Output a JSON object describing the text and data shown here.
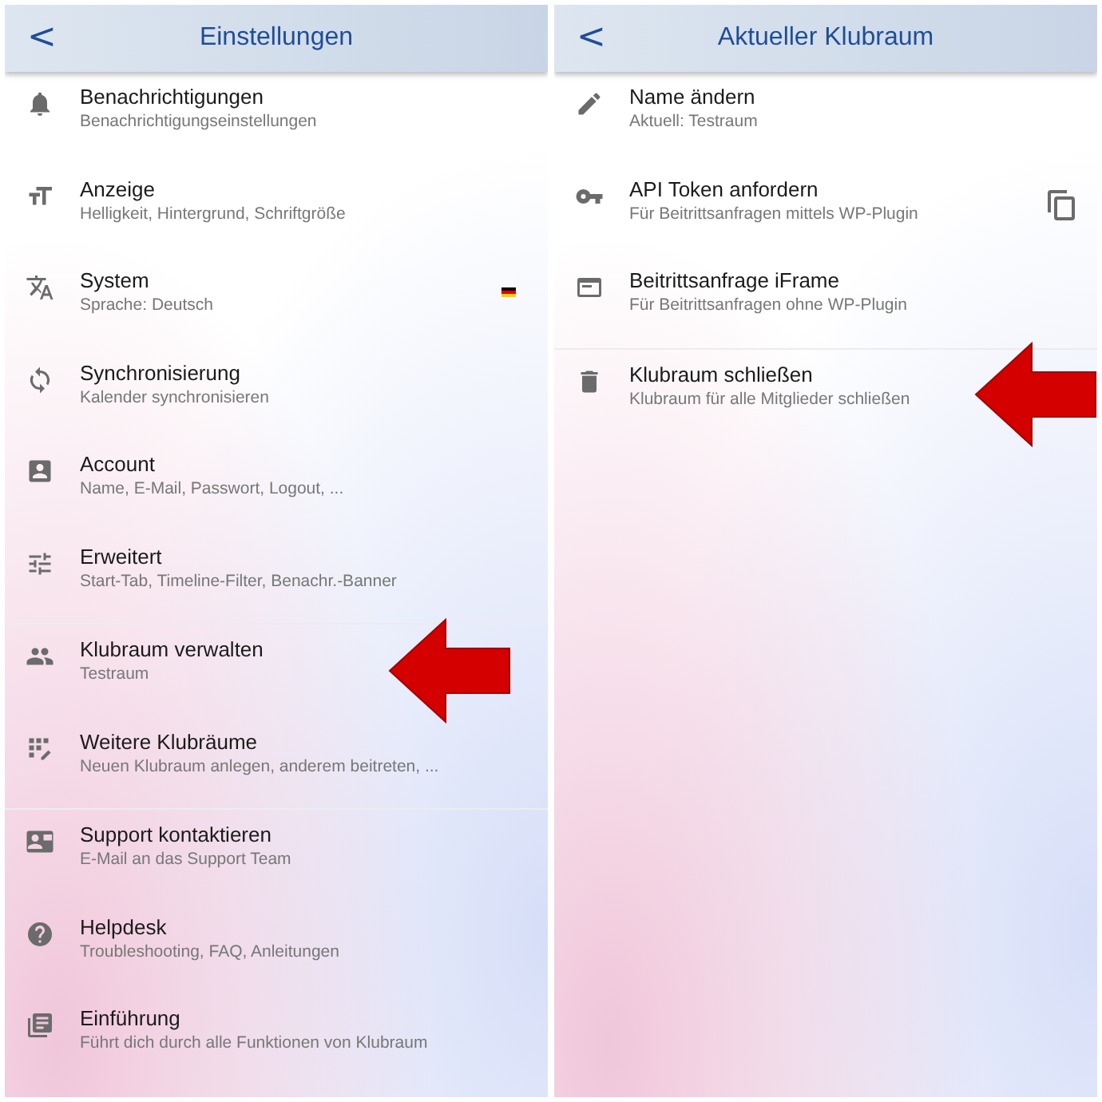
{
  "panels": [
    {
      "title": "Einstellungen",
      "back": "<",
      "sections": [
        [
          {
            "title": "Benachrichtigungen",
            "subtitle": "Benachrichtigungseinstellungen",
            "kind": "plain",
            "highlighted": false
          },
          {
            "title": "Anzeige",
            "subtitle": "Helligkeit, Hintergrund, Schriftgröße",
            "kind": "plain",
            "highlighted": false
          },
          {
            "title": "System",
            "subtitle": "Sprache: Deutsch",
            "kind": "flag",
            "highlighted": false
          },
          {
            "title": "Synchronisierung",
            "subtitle": "Kalender synchronisieren",
            "kind": "plain",
            "highlighted": false
          },
          {
            "title": "Account",
            "subtitle": "Name, E-Mail, Passwort, Logout, ...",
            "kind": "plain",
            "highlighted": false
          },
          {
            "title": "Erweitert",
            "subtitle": "Start-Tab, Timeline-Filter, Benachr.-Banner",
            "kind": "plain",
            "highlighted": false
          }
        ],
        [
          {
            "title": "Klubraum verwalten",
            "subtitle": "Testraum",
            "kind": "plain",
            "highlighted": true
          },
          {
            "title": "Weitere Klubräume",
            "subtitle": "Neuen Klubraum anlegen, anderem beitreten, ...",
            "kind": "plain",
            "highlighted": false
          }
        ],
        [
          {
            "title": "Support kontaktieren",
            "subtitle": "E-Mail an das Support Team",
            "kind": "plain",
            "highlighted": false
          },
          {
            "title": "Helpdesk",
            "subtitle": "Troubleshooting, FAQ, Anleitungen",
            "kind": "plain",
            "highlighted": false
          },
          {
            "title": "Einführung",
            "subtitle": "Führt dich durch alle Funktionen von Klubraum",
            "kind": "plain",
            "highlighted": false
          }
        ]
      ]
    },
    {
      "title": "Aktueller Klubraum",
      "back": "<",
      "sections": [
        [
          {
            "title": "Name ändern",
            "subtitle": "Aktuell: Testraum",
            "kind": "plain",
            "highlighted": false
          },
          {
            "title": "API Token anfordern",
            "subtitle": "Für Beitrittsanfragen mittels WP-Plugin",
            "kind": "copy",
            "highlighted": false
          },
          {
            "title": "Beitrittsanfrage iFrame",
            "subtitle": "Für Beitrittsanfragen ohne WP-Plugin",
            "kind": "plain",
            "highlighted": false
          }
        ],
        [
          {
            "title": "Klubraum schließen",
            "subtitle": "Klubraum für alle Mitglieder schließen",
            "kind": "plain",
            "highlighted": true
          }
        ]
      ]
    }
  ]
}
